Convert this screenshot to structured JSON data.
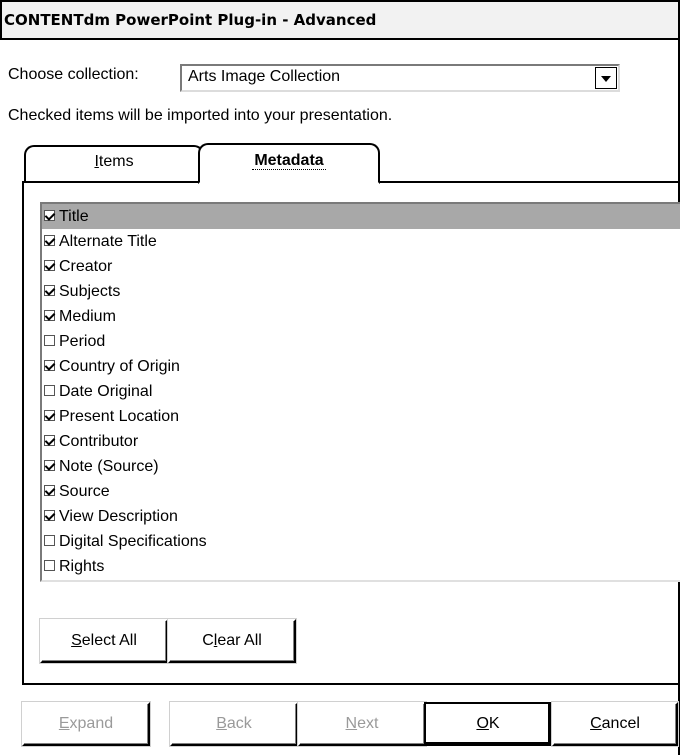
{
  "window": {
    "title": "CONTENTdm PowerPoint Plug-in - Advanced"
  },
  "collection": {
    "label": "Choose collection:",
    "selected": "Arts Image Collection"
  },
  "instructions": "Checked items will be imported into your presentation.",
  "tabs": [
    {
      "label": "Items",
      "mnemonic": "I",
      "rest": "tems",
      "active": false
    },
    {
      "label": "Metadata",
      "active": true
    }
  ],
  "fields": [
    {
      "label": "Title",
      "checked": true,
      "selected": true
    },
    {
      "label": "Alternate Title",
      "checked": true
    },
    {
      "label": "Creator",
      "checked": true
    },
    {
      "label": "Subjects",
      "checked": true
    },
    {
      "label": "Medium",
      "checked": true
    },
    {
      "label": "Period",
      "checked": false
    },
    {
      "label": "Country of Origin",
      "checked": true
    },
    {
      "label": "Date Original",
      "checked": false
    },
    {
      "label": "Present Location",
      "checked": true
    },
    {
      "label": "Contributor",
      "checked": true
    },
    {
      "label": "Note (Source)",
      "checked": true
    },
    {
      "label": "Source",
      "checked": true
    },
    {
      "label": "View Description",
      "checked": true
    },
    {
      "label": "Digital Specifications",
      "checked": false
    },
    {
      "label": "Rights",
      "checked": false
    }
  ],
  "panel_buttons": {
    "select_all": {
      "label": "Select All",
      "pre": "",
      "mnemonic": "S",
      "post": "elect All"
    },
    "clear_all": {
      "label": "Clear All",
      "pre": "C",
      "mnemonic": "l",
      "post": "ear All"
    }
  },
  "footer_buttons": {
    "expand": {
      "label": "Expand",
      "mnemonic": "E",
      "rest": "xpand",
      "enabled": false
    },
    "back": {
      "label": "Back",
      "mnemonic": "B",
      "rest": "ack",
      "enabled": false
    },
    "next": {
      "label": "Next",
      "mnemonic": "N",
      "rest": "ext",
      "enabled": false
    },
    "ok": {
      "label": "OK",
      "mnemonic": "O",
      "rest": "K",
      "enabled": true
    },
    "cancel": {
      "label": "Cancel",
      "mnemonic": "C",
      "rest": "ancel",
      "enabled": true
    }
  }
}
